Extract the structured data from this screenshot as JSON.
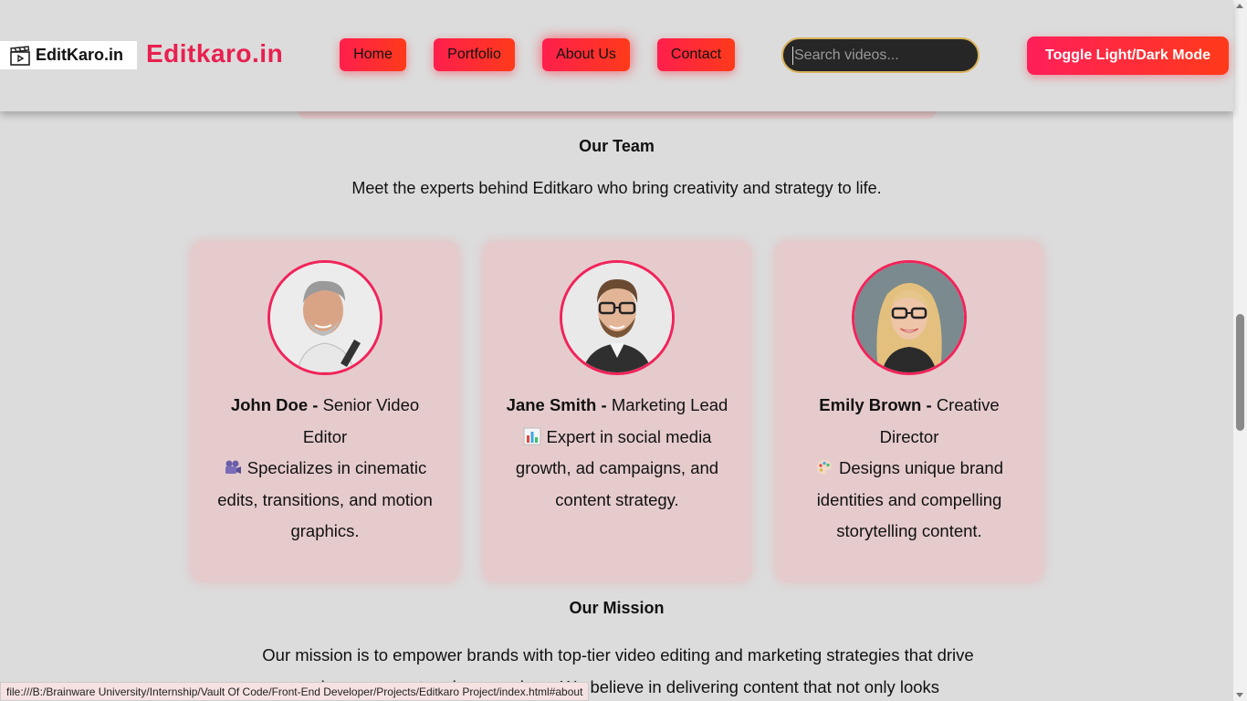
{
  "header": {
    "logo_text": "EditKaro.in",
    "brand_title": "Editkaro.in",
    "nav": {
      "home": "Home",
      "portfolio": "Portfolio",
      "about": "About Us",
      "contact": "Contact"
    },
    "search_placeholder": "Search videos...",
    "toggle_label": "Toggle Light/Dark Mode"
  },
  "team": {
    "title": "Our Team",
    "intro": "Meet the experts behind Editkaro who bring creativity and strategy to life.",
    "members": [
      {
        "name": "John Doe",
        "role_sep": " - ",
        "role": "Senior Video Editor",
        "icon": "film-camera-icon",
        "desc": "Specializes in cinematic edits, transitions, and motion graphics."
      },
      {
        "name": "Jane Smith",
        "role_sep": " - ",
        "role": "Marketing Lead",
        "icon": "bar-chart-icon",
        "desc": "Expert in social media growth, ad campaigns, and content strategy."
      },
      {
        "name": "Emily Brown",
        "role_sep": " - ",
        "role": "Creative Director",
        "icon": "palette-icon",
        "desc": "Designs unique brand identities and compelling storytelling content."
      }
    ]
  },
  "mission": {
    "title": "Our Mission",
    "text": "Our mission is to empower brands with top-tier video editing and marketing strategies that drive real engagement and conversions. We believe in delivering content that not only looks"
  },
  "status_url": "file:///B:/Brainware University/Internship/Vault Of Code/Front-End Developer/Projects/Editkaro Project/index.html#about",
  "colors": {
    "accent": "#f0245a",
    "button_gradient_start": "#ff1f4d",
    "button_gradient_end": "#ff3a1a",
    "card_bg": "#e6cbcd",
    "page_bg": "#dcdcdc"
  }
}
